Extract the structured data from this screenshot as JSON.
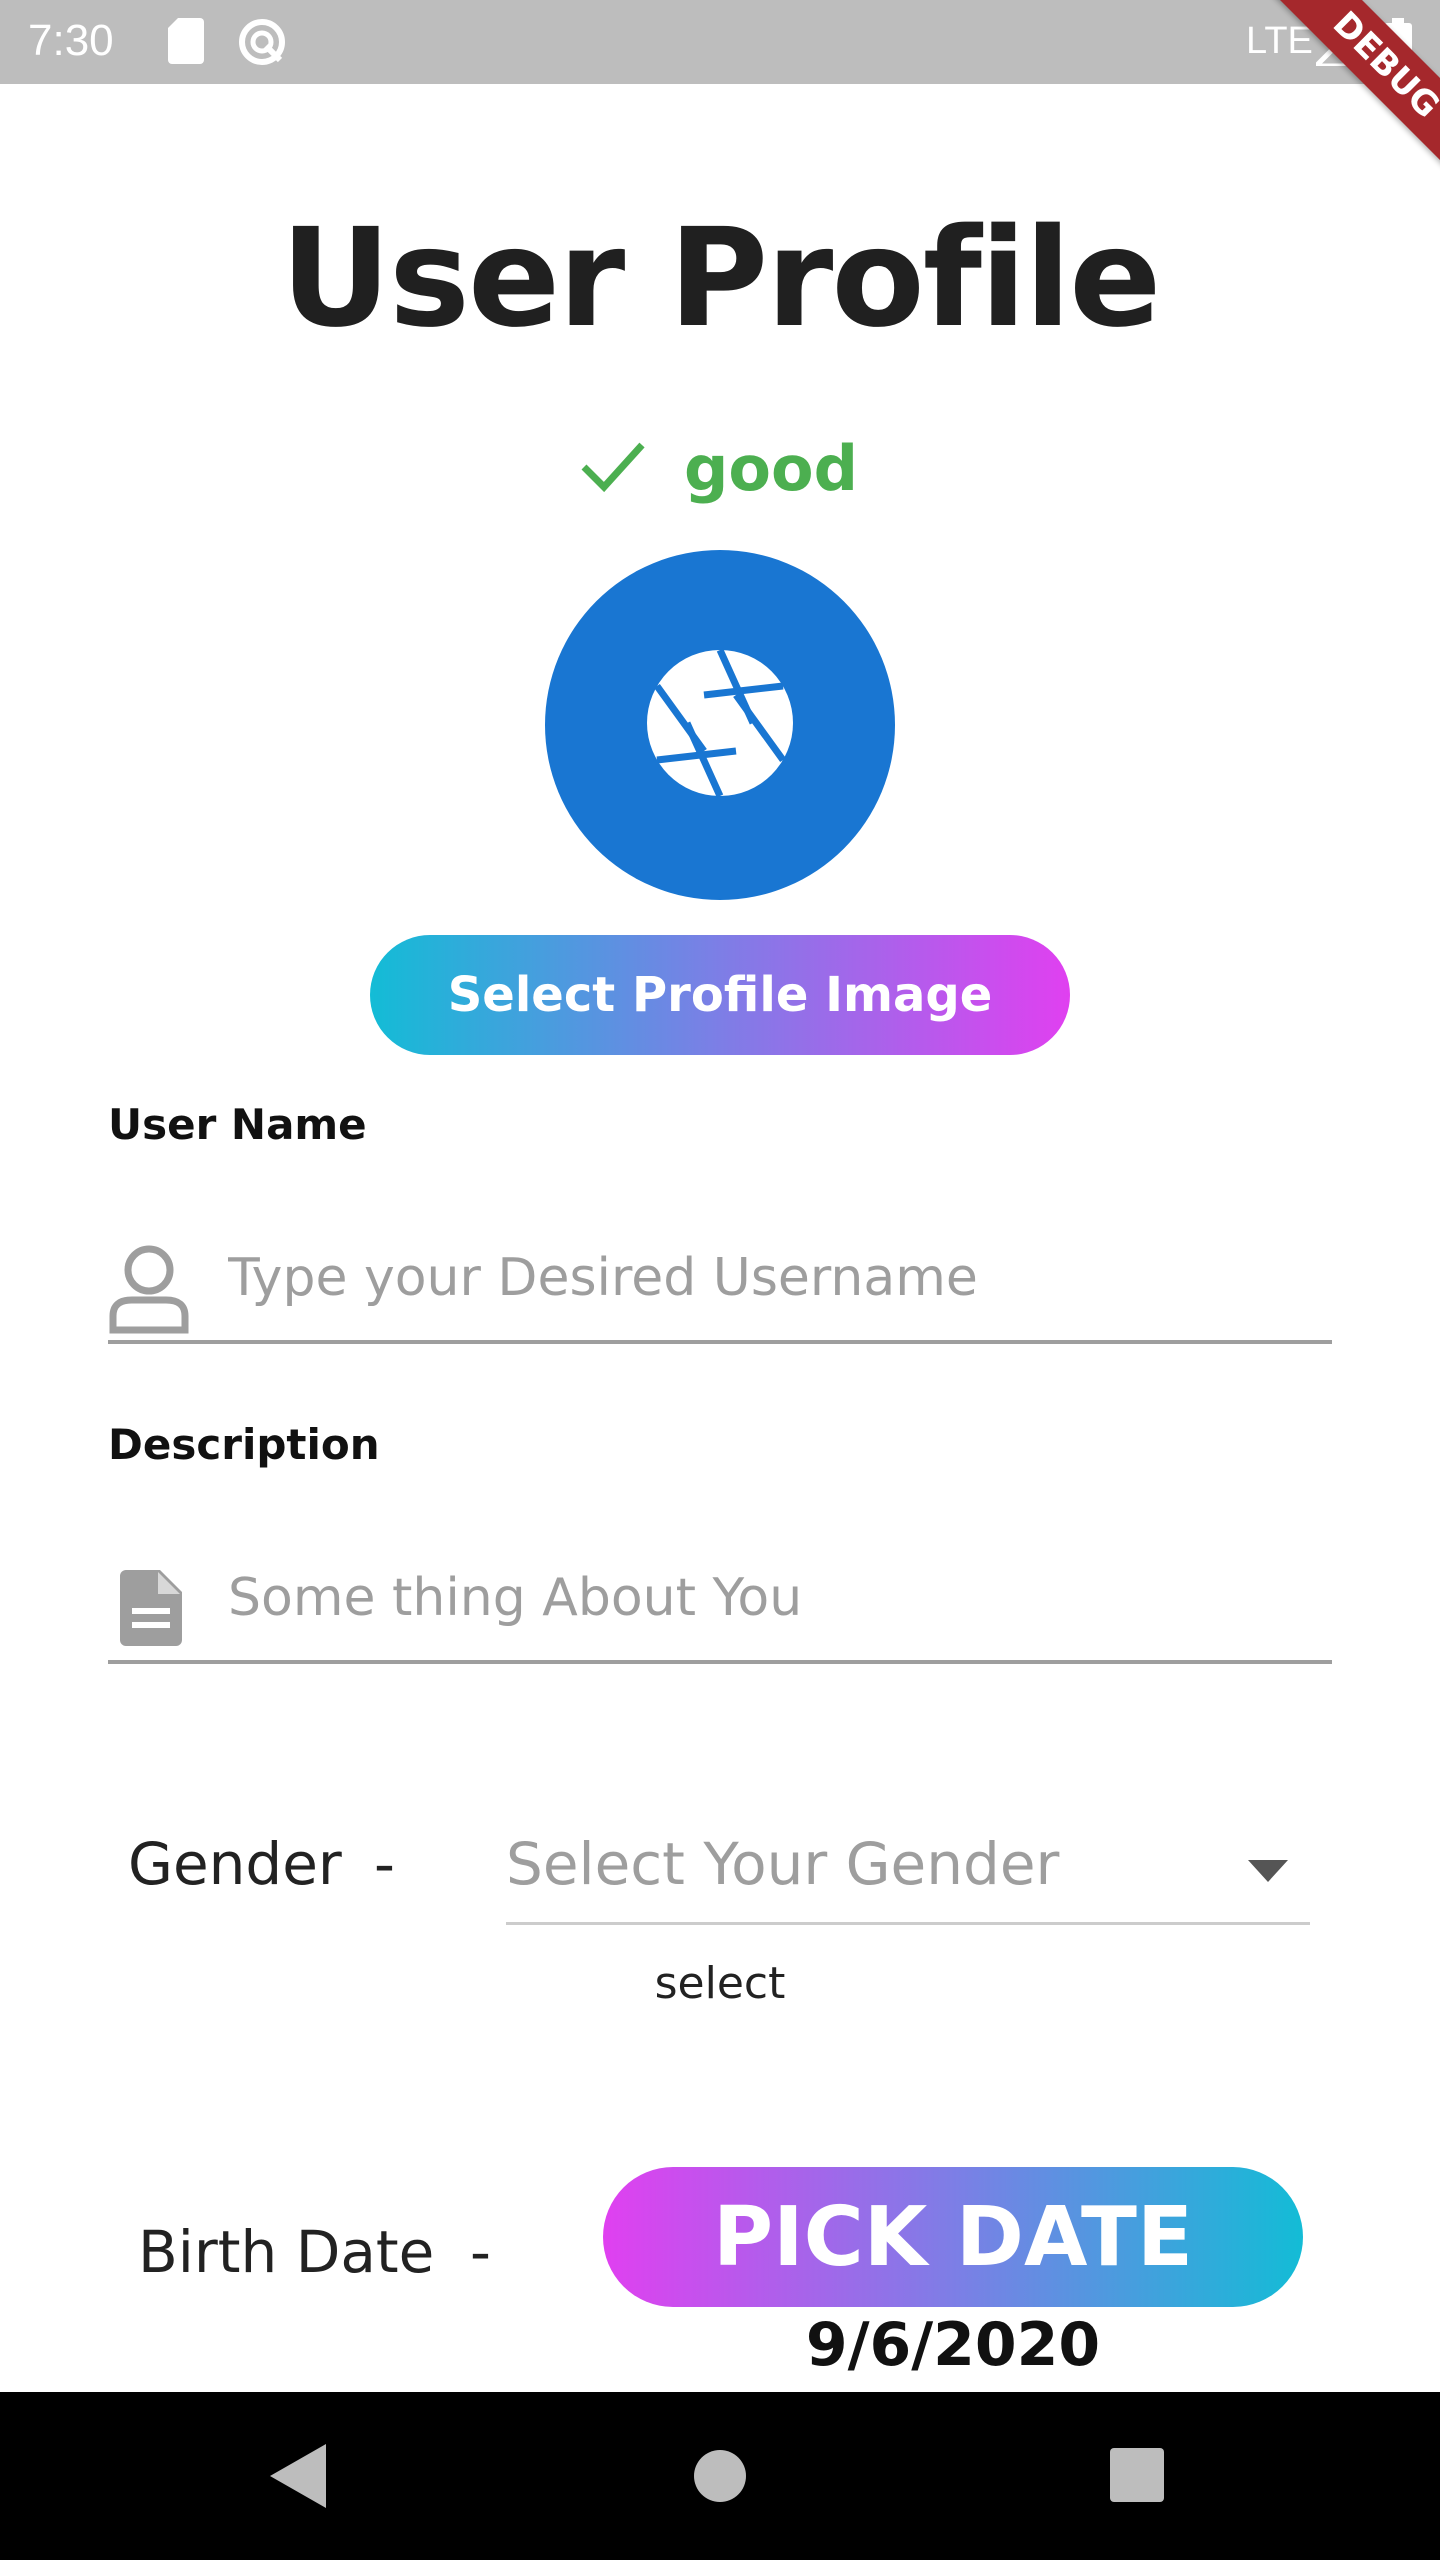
{
  "status_bar": {
    "time": "7:30",
    "network": "LTE",
    "icons": [
      "sd-card-icon",
      "sync-icon",
      "signal-icon",
      "battery-icon"
    ],
    "debug_banner": "DEBUG"
  },
  "page": {
    "title": "User Profile",
    "status_icon": "check-icon",
    "status_text": "good",
    "status_color": "#4caf50"
  },
  "avatar": {
    "icon": "camera-shutter-icon",
    "color": "#1976d2"
  },
  "select_image_button": {
    "label": "Select Profile Image",
    "gradient": [
      "#13bcd6",
      "#e040f0"
    ]
  },
  "username": {
    "label": "User Name",
    "icon": "person-icon",
    "placeholder": "Type your Desired Username",
    "value": ""
  },
  "description": {
    "label": "Description",
    "icon": "document-icon",
    "placeholder": "Some thing About You",
    "value": ""
  },
  "gender": {
    "label": "Gender",
    "dash": "-",
    "placeholder": "Select Your Gender",
    "helper": "select"
  },
  "birth_date": {
    "label": "Birth Date",
    "dash": "-",
    "button_label": "PICK DATE",
    "value": "9/6/2020"
  },
  "nav": {
    "back": "back-icon",
    "home": "home-icon",
    "recents": "recents-icon"
  }
}
